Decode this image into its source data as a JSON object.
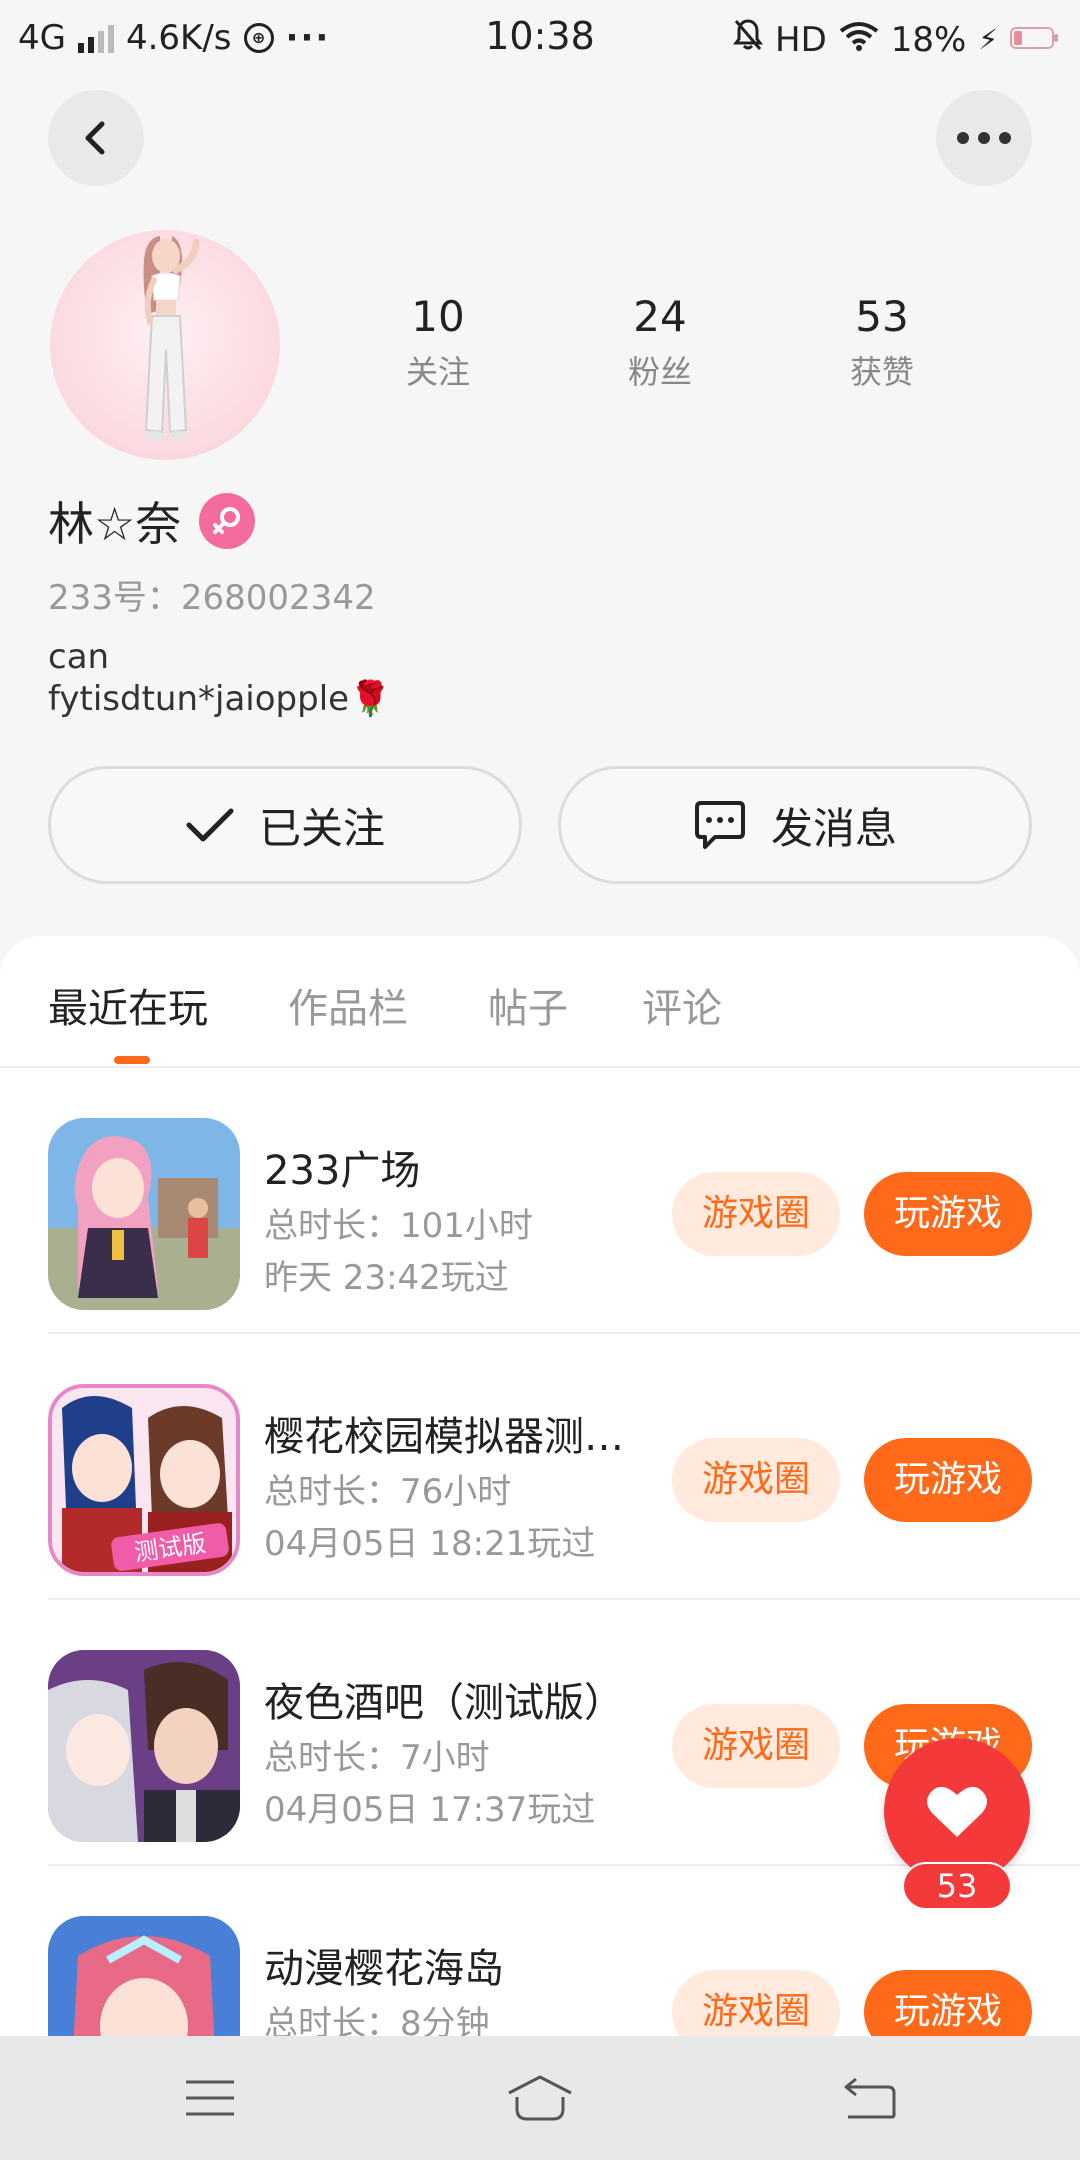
{
  "status_bar": {
    "network": "4G",
    "speed": "4.6K/s",
    "time": "10:38",
    "hd": "HD",
    "battery": "18%"
  },
  "profile": {
    "stats": [
      {
        "num": "10",
        "label": "关注"
      },
      {
        "num": "24",
        "label": "粉丝"
      },
      {
        "num": "53",
        "label": "获赞"
      }
    ],
    "username": "林☆奈",
    "uid": "233号：268002342",
    "bio": "can\nfytisdtun*jaiopple🌹",
    "follow_label": "已关注",
    "message_label": "发消息"
  },
  "tabs": [
    "最近在玩",
    "作品栏",
    "帖子",
    "评论"
  ],
  "active_tab": 0,
  "games": [
    {
      "name": "233广场",
      "total": "总时长：101小时",
      "last": "昨天 23:42玩过",
      "circle_label": "游戏圈",
      "play_label": "玩游戏"
    },
    {
      "name": "樱花校园模拟器测…",
      "total": "总时长：76小时",
      "last": "04月05日 18:21玩过",
      "circle_label": "游戏圈",
      "play_label": "玩游戏"
    },
    {
      "name": "夜色酒吧（测试版）",
      "total": "总时长：7小时",
      "last": "04月05日 17:37玩过",
      "circle_label": "游戏圈",
      "play_label": "玩游戏"
    },
    {
      "name": "动漫樱花海岛",
      "total": "总时长：8分钟",
      "last": "",
      "circle_label": "游戏圈",
      "play_label": "玩游戏"
    }
  ],
  "like_fab": {
    "count": "53"
  },
  "colors": {
    "accent": "#ff6a1a",
    "accent_light": "#ffeadd",
    "like": "#f4393a",
    "gender": "#f46b9d"
  },
  "icons": [
    "back-arrow-icon",
    "more-icon",
    "checkmark-icon",
    "chat-bubble-icon",
    "heart-icon",
    "menu-icon",
    "home-icon",
    "back-nav-icon"
  ]
}
